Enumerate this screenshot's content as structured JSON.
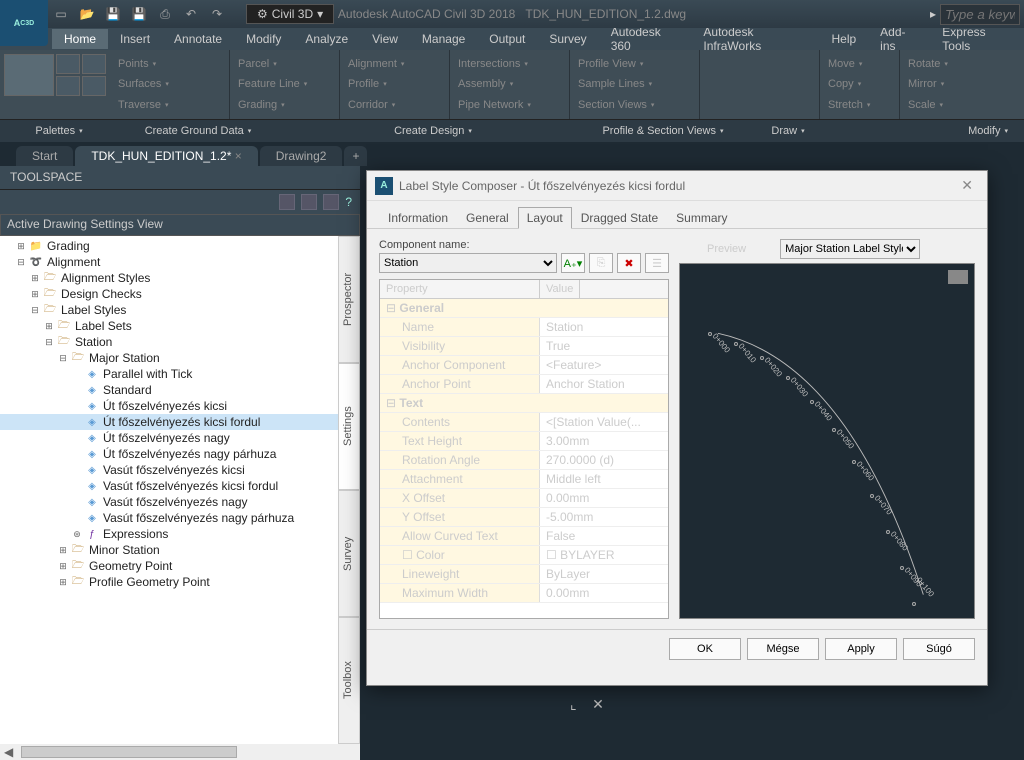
{
  "app": {
    "title": "Autodesk AutoCAD Civil 3D 2018",
    "doc": "TDK_HUN_EDITION_1.2.dwg",
    "workspace": "Civil 3D",
    "search_placeholder": "Type a keyw"
  },
  "menus": [
    "Home",
    "Insert",
    "Annotate",
    "Modify",
    "Analyze",
    "View",
    "Manage",
    "Output",
    "Survey",
    "Autodesk 360",
    "Autodesk InfraWorks",
    "Help",
    "Add-ins",
    "Express Tools"
  ],
  "ribbon": {
    "g1": [
      "Points",
      "Surfaces",
      "Traverse"
    ],
    "g2": [
      "Parcel",
      "Feature Line",
      "Grading"
    ],
    "g3a": [
      "Alignment",
      "Profile",
      "Corridor"
    ],
    "g3b": [
      "Intersections",
      "Assembly",
      "Pipe Network"
    ],
    "g4": [
      "Profile View",
      "Sample Lines",
      "Section Views"
    ],
    "g5": [
      "Move",
      "Copy",
      "Stretch"
    ],
    "g6": [
      "Rotate",
      "Mirror",
      "Scale"
    ]
  },
  "panels": {
    "p1": "Palettes",
    "p2": "Create Ground Data",
    "p3": "Create Design",
    "p4": "Profile & Section Views",
    "p5": "Draw",
    "p6": "Modify"
  },
  "doctabs": {
    "t1": "Start",
    "t2": "TDK_HUN_EDITION_1.2*",
    "t3": "Drawing2"
  },
  "toolspace": {
    "title": "TOOLSPACE",
    "combo": "Active Drawing Settings View"
  },
  "side_tabs": [
    "Prospector",
    "Settings",
    "Survey",
    "Toolbox"
  ],
  "tree": {
    "grading": "Grading",
    "alignment": "Alignment",
    "align_styles": "Alignment Styles",
    "design_checks": "Design Checks",
    "label_styles": "Label Styles",
    "label_sets": "Label Sets",
    "station": "Station",
    "major_station": "Major Station",
    "it1": "Parallel with Tick",
    "it2": "Standard",
    "it3": "Út főszelvényezés kicsi",
    "it4": "Út főszelvényezés kicsi fordul",
    "it5": "Út főszelvényezés nagy",
    "it6": "Út főszelvényezés nagy párhuza",
    "it7": "Vasút főszelvényezés kicsi",
    "it8": "Vasút főszelvényezés kicsi fordul",
    "it9": "Vasút főszelvényezés nagy",
    "it10": "Vasút főszelvényezés nagy párhuza",
    "expr": "Expressions",
    "minor": "Minor Station",
    "geom": "Geometry Point",
    "prof_geom": "Profile Geometry Point"
  },
  "dlg": {
    "title": "Label Style Composer - Út főszelvényezés kicsi fordul",
    "tabs": [
      "Information",
      "General",
      "Layout",
      "Dragged State",
      "Summary"
    ],
    "comp_lbl": "Component name:",
    "comp_val": "Station",
    "grid_head": {
      "c1": "Property",
      "c2": "Value"
    },
    "cat1": "General",
    "r1": {
      "p": "Name",
      "v": "Station"
    },
    "r2": {
      "p": "Visibility",
      "v": "True"
    },
    "r3": {
      "p": "Anchor Component",
      "v": "<Feature>"
    },
    "r4": {
      "p": "Anchor Point",
      "v": "Anchor Station"
    },
    "cat2": "Text",
    "r5": {
      "p": "Contents",
      "v": "<[Station Value(..."
    },
    "r6": {
      "p": "Text Height",
      "v": "3.00mm"
    },
    "r7": {
      "p": "Rotation Angle",
      "v": "270.0000 (d)"
    },
    "r8": {
      "p": "Attachment",
      "v": "Middle left"
    },
    "r9": {
      "p": "X Offset",
      "v": "0.00mm"
    },
    "r10": {
      "p": "Y Offset",
      "v": "-5.00mm"
    },
    "r11": {
      "p": "Allow Curved Text",
      "v": "False"
    },
    "r12": {
      "p": "Color",
      "v": "BYLAYER"
    },
    "r13": {
      "p": "Lineweight",
      "v": "ByLayer"
    },
    "r14": {
      "p": "Maximum Width",
      "v": "0.00mm"
    },
    "preview_lbl": "Preview",
    "preview_sel": "Major Station Label Style",
    "btns": {
      "ok": "OK",
      "cancel": "Mégse",
      "apply": "Apply",
      "help": "Súgó"
    }
  },
  "chart_data": {
    "type": "line",
    "title": "Major Station Label Style preview",
    "ticks": [
      "0+000",
      "0+010",
      "0+020",
      "0+030",
      "0+040",
      "0+050",
      "0+060",
      "0+070",
      "0+080",
      "0+090",
      "0+100"
    ]
  }
}
